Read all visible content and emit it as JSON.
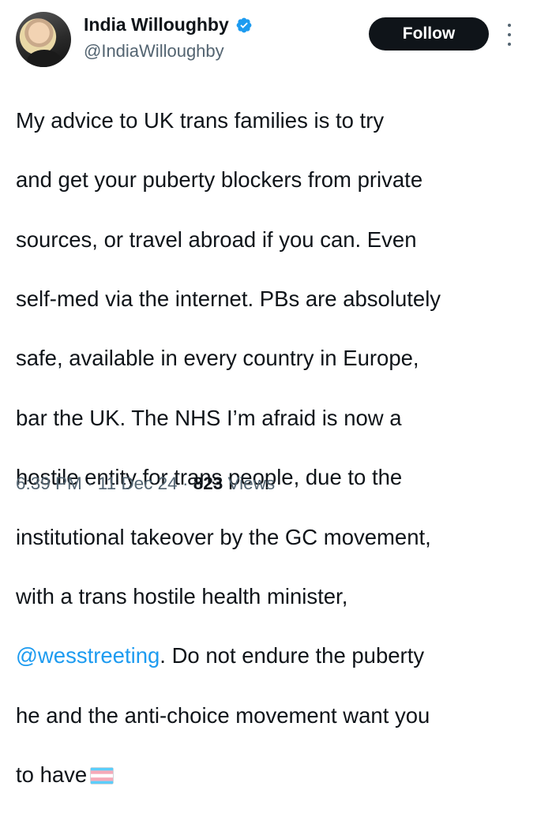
{
  "author": {
    "display_name": "India Willoughby",
    "handle": "@IndiaWilloughby",
    "verified": true,
    "avatar_icon": "profile-photo"
  },
  "follow_label": "Follow",
  "more_icon": "vertical-ellipsis-icon",
  "tweet": {
    "lines": [
      "My advice to UK trans families is to try",
      "and get your puberty blockers from private",
      "sources, or travel abroad if you can. Even",
      "self-med via the internet. PBs are absolutely",
      "safe, available in every country in Europe,",
      "bar the UK. The NHS I’m afraid is now a",
      "hostile entity for trans people, due to the",
      "institutional takeover by the GC movement,",
      "with a trans hostile health minister,"
    ],
    "mention": "@wesstreeting",
    "after_mention": ". Do not endure the puberty",
    "line_11": "he and the anti-choice movement want you",
    "line_12": "to have",
    "emoji": "transgender-flag-emoji"
  },
  "meta": {
    "time": "6:39 PM",
    "separator": " · ",
    "date": "11 Dec 24",
    "views_count": "823",
    "views_label": " Views"
  },
  "colors": {
    "text": "#0f1419",
    "secondary": "#536471",
    "link": "#1d9bf0",
    "button_bg": "#0f1419",
    "verified": "#1d9bf0"
  }
}
